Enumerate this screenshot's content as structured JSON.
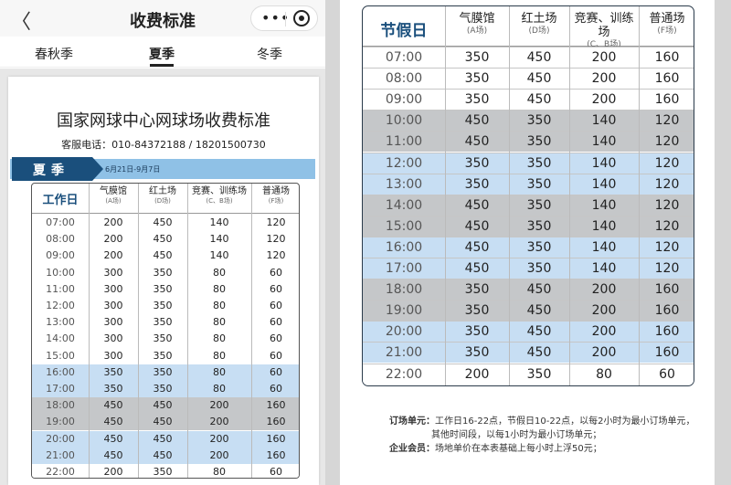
{
  "nav": {
    "back_icon": "chevron-left-icon",
    "title": "收费标准",
    "more_icon": "more-dots-icon",
    "more_glyph": "•••",
    "target_icon": "record-target-icon"
  },
  "tabs": [
    "春秋季",
    "夏季",
    "冬季"
  ],
  "active_tab": "夏季",
  "doc": {
    "title": "国家网球中心网球场收费标准",
    "phone": "客服电话：010-84372188 / 18201500730",
    "season": "夏季",
    "season_date": "6月21日-9月7日"
  },
  "colors": {
    "header_text": "#1a4f7c",
    "season_tag": "#1a4f7c",
    "season_bar": "#8fc1e6",
    "gray_row": "#c5c7c9",
    "blue_row": "#c7def3"
  },
  "columns": [
    {
      "name": "气膜馆",
      "sub": "(A场)"
    },
    {
      "name": "红土场",
      "sub": "(D场)"
    },
    {
      "name": "竞赛、训练场",
      "sub": "(C、B场)"
    },
    {
      "name": "普通场",
      "sub": "(F场)"
    }
  ],
  "weekday_table": {
    "header": "工作日",
    "rows": [
      {
        "time": "07:00",
        "vals": [
          "200",
          "450",
          "140",
          "120"
        ],
        "shade": "white"
      },
      {
        "time": "08:00",
        "vals": [
          "200",
          "450",
          "140",
          "120"
        ],
        "shade": "white"
      },
      {
        "time": "09:00",
        "vals": [
          "200",
          "450",
          "140",
          "120"
        ],
        "shade": "white"
      },
      {
        "time": "10:00",
        "vals": [
          "300",
          "350",
          "80",
          "60"
        ],
        "shade": "white"
      },
      {
        "time": "11:00",
        "vals": [
          "300",
          "350",
          "80",
          "60"
        ],
        "shade": "white"
      },
      {
        "time": "12:00",
        "vals": [
          "300",
          "350",
          "80",
          "60"
        ],
        "shade": "white"
      },
      {
        "time": "13:00",
        "vals": [
          "300",
          "350",
          "80",
          "60"
        ],
        "shade": "white"
      },
      {
        "time": "14:00",
        "vals": [
          "300",
          "350",
          "80",
          "60"
        ],
        "shade": "white"
      },
      {
        "time": "15:00",
        "vals": [
          "300",
          "350",
          "80",
          "60"
        ],
        "shade": "white"
      },
      {
        "time": "16:00",
        "vals": [
          "350",
          "350",
          "80",
          "60"
        ],
        "shade": "blue"
      },
      {
        "time": "17:00",
        "vals": [
          "350",
          "350",
          "80",
          "60"
        ],
        "shade": "blue"
      },
      {
        "time": "18:00",
        "vals": [
          "450",
          "450",
          "200",
          "160"
        ],
        "shade": "gray"
      },
      {
        "time": "19:00",
        "vals": [
          "450",
          "450",
          "200",
          "160"
        ],
        "shade": "gray"
      },
      {
        "time": "20:00",
        "vals": [
          "450",
          "450",
          "200",
          "160"
        ],
        "shade": "blue"
      },
      {
        "time": "21:00",
        "vals": [
          "450",
          "450",
          "200",
          "160"
        ],
        "shade": "blue"
      },
      {
        "time": "22:00",
        "vals": [
          "200",
          "350",
          "80",
          "60"
        ],
        "shade": "white"
      }
    ]
  },
  "holiday_table": {
    "header": "节假日",
    "rows": [
      {
        "time": "07:00",
        "vals": [
          "350",
          "450",
          "200",
          "160"
        ],
        "shade": "white"
      },
      {
        "time": "08:00",
        "vals": [
          "350",
          "450",
          "200",
          "160"
        ],
        "shade": "white"
      },
      {
        "time": "09:00",
        "vals": [
          "350",
          "450",
          "200",
          "160"
        ],
        "shade": "white"
      },
      {
        "time": "10:00",
        "vals": [
          "450",
          "350",
          "140",
          "120"
        ],
        "shade": "gray"
      },
      {
        "time": "11:00",
        "vals": [
          "450",
          "350",
          "140",
          "120"
        ],
        "shade": "gray"
      },
      {
        "time": "12:00",
        "vals": [
          "350",
          "350",
          "140",
          "120"
        ],
        "shade": "blue"
      },
      {
        "time": "13:00",
        "vals": [
          "350",
          "350",
          "140",
          "120"
        ],
        "shade": "blue"
      },
      {
        "time": "14:00",
        "vals": [
          "450",
          "350",
          "140",
          "120"
        ],
        "shade": "gray"
      },
      {
        "time": "15:00",
        "vals": [
          "450",
          "350",
          "140",
          "120"
        ],
        "shade": "gray"
      },
      {
        "time": "16:00",
        "vals": [
          "450",
          "350",
          "140",
          "120"
        ],
        "shade": "blue"
      },
      {
        "time": "17:00",
        "vals": [
          "450",
          "350",
          "140",
          "120"
        ],
        "shade": "blue"
      },
      {
        "time": "18:00",
        "vals": [
          "350",
          "450",
          "200",
          "160"
        ],
        "shade": "gray"
      },
      {
        "time": "19:00",
        "vals": [
          "350",
          "450",
          "200",
          "160"
        ],
        "shade": "gray"
      },
      {
        "time": "20:00",
        "vals": [
          "350",
          "450",
          "200",
          "160"
        ],
        "shade": "blue"
      },
      {
        "time": "21:00",
        "vals": [
          "350",
          "450",
          "200",
          "160"
        ],
        "shade": "blue"
      },
      {
        "time": "22:00",
        "vals": [
          "200",
          "350",
          "80",
          "60"
        ],
        "shade": "white"
      }
    ]
  },
  "notes": {
    "unit_label": "订场单元：",
    "unit_line1": "工作日16-22点，节假日10-22点，以每2小时为最小订场单元，",
    "unit_line2": "其他时间段，以每1小时为最小订场单元；",
    "member_label": "企业会员：",
    "member_text": "场地单价在本表基础上每小时上浮50元；"
  }
}
